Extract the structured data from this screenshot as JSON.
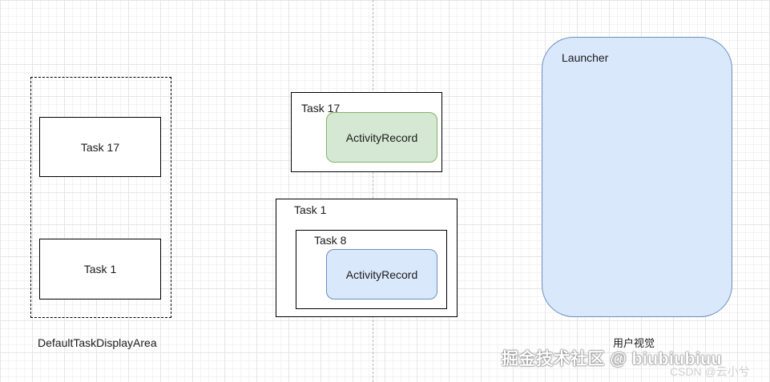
{
  "left": {
    "area_label": "DefaultTaskDisplayArea",
    "task_top": "Task 17",
    "task_bottom": "Task 1"
  },
  "middle": {
    "task17_label": "Task 17",
    "task17_activity": "ActivityRecord",
    "task1_label": "Task 1",
    "task8_label": "Task 8",
    "task8_activity": "ActivityRecord"
  },
  "right": {
    "launcher_label": "Launcher",
    "caption": "用户视觉"
  },
  "watermark": {
    "main": "掘金技术社区 @ biubiubiuu",
    "sub": "CSDN @云小兮"
  },
  "colors": {
    "green_fill": "#d5e8d4",
    "green_stroke": "#82b366",
    "blue_fill": "#dae8fc",
    "blue_stroke": "#6c8ebf"
  }
}
